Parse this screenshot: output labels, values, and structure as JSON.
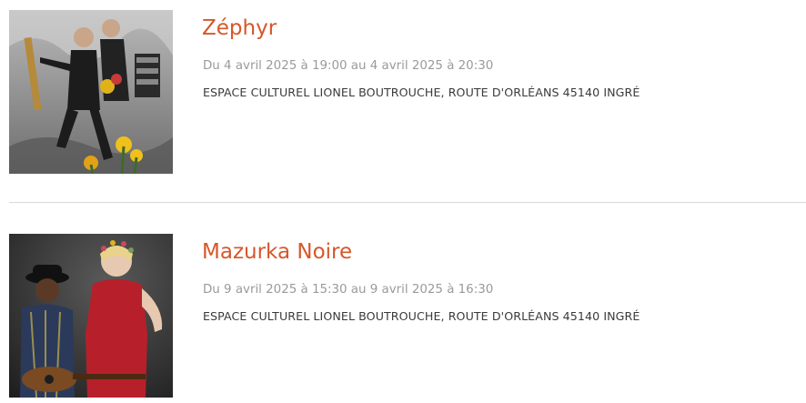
{
  "events": [
    {
      "title": "Zéphyr",
      "dates": "Du 4 avril 2025 à 19:00 au 4 avril 2025 à 20:30",
      "venue": "ESPACE CULTUREL LIONEL BOUTROUCHE, ROUTE D'ORLÉANS 45140 INGRÉ"
    },
    {
      "title": "Mazurka Noire",
      "dates": "Du 9 avril 2025 à 15:30 au 9 avril 2025 à 16:30",
      "venue": "ESPACE CULTUREL LIONEL BOUTROUCHE, ROUTE D'ORLÉANS 45140 INGRÉ"
    }
  ],
  "colors": {
    "title_accent": "#d6572a",
    "date_text": "#9a9a9a",
    "venue_text": "#3a3a3a",
    "divider": "#d9d9d9"
  }
}
